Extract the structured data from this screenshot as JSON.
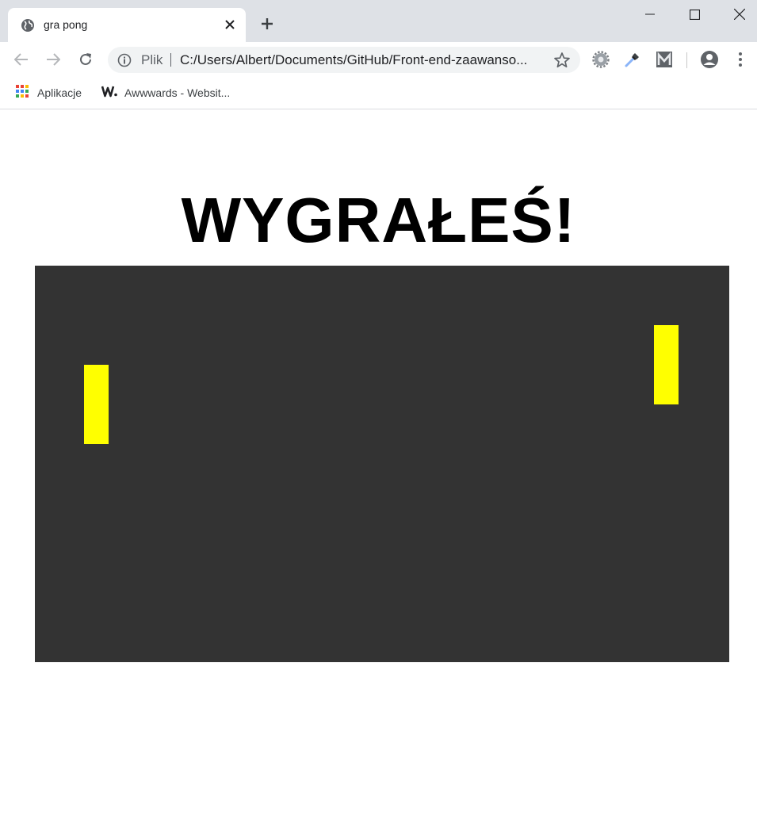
{
  "browser": {
    "tab_title": "gra pong",
    "address_scheme_label": "Plik",
    "url": "C:/Users/Albert/Documents/GitHub/Front-end-zaawanso...",
    "icons": {
      "favicon": "globe-icon",
      "close_tab": "close-icon",
      "new_tab": "plus-icon",
      "back": "arrow-left-icon",
      "forward": "arrow-right-icon",
      "reload": "reload-icon",
      "site_info": "info-icon",
      "bookmark": "star-icon",
      "extensions": [
        "gear-icon",
        "eyedropper-icon",
        "m-logo-icon"
      ],
      "profile": "account-icon",
      "menu": "kebab-menu-icon"
    }
  },
  "bookmarks": [
    {
      "label": "Aplikacje",
      "icon": "apps-grid-icon"
    },
    {
      "label": "Awwwards - Websit...",
      "icon": "w-logo-icon"
    }
  ],
  "page": {
    "heading": "WYGRAŁEŚ!",
    "colors": {
      "board": "#333333",
      "paddle": "#ffff00",
      "heading": "#000000"
    }
  }
}
